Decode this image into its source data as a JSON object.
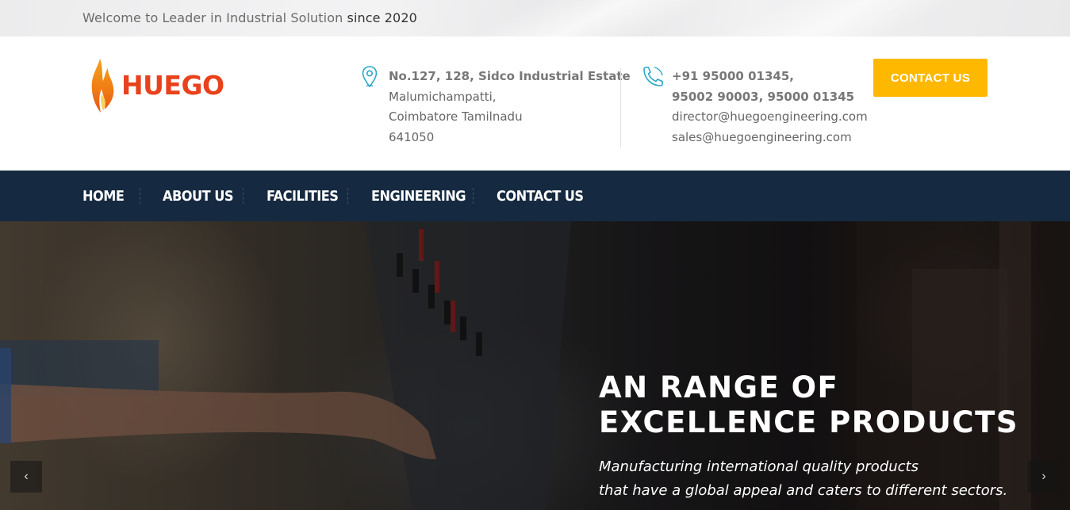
{
  "topbar": {
    "welcome": "Welcome to Leader in Industrial Solution",
    "since": "since 2020"
  },
  "brand": {
    "name": "HUEGO",
    "logo_icon": "flame-icon",
    "color": "#e8421c"
  },
  "contact": {
    "address_icon": "map-pin-icon",
    "address_line1": "No.127, 128, Sidco Industrial Estate",
    "address_line2": "Malumichampatti,",
    "address_line3": "Coimbatore Tamilnadu",
    "address_line4": "641050",
    "phone_icon": "phone-icon",
    "phone_line1": "+91 95000 01345,",
    "phone_line2": "95002 90003, 95000 01345",
    "email1": "director@huegoengineering.com",
    "email2": "sales@huegoengineering.com",
    "cta_label": "CONTACT US",
    "cta_color": "#ffb800"
  },
  "nav": {
    "items": [
      {
        "label": "HOME"
      },
      {
        "label": "ABOUT US"
      },
      {
        "label": "FACILITIES"
      },
      {
        "label": "ENGINEERING"
      },
      {
        "label": "CONTACT US"
      }
    ],
    "background": "#152a40"
  },
  "hero": {
    "title_line1": "AN RANGE OF",
    "title_line2": "EXCELLENCE PRODUCTS",
    "subtitle_line1": "Manufacturing international quality products",
    "subtitle_line2": "that have a global appeal and caters to different sectors.",
    "prev_icon": "chevron-left-icon",
    "next_icon": "chevron-right-icon",
    "prev_glyph": "‹",
    "next_glyph": "›"
  }
}
